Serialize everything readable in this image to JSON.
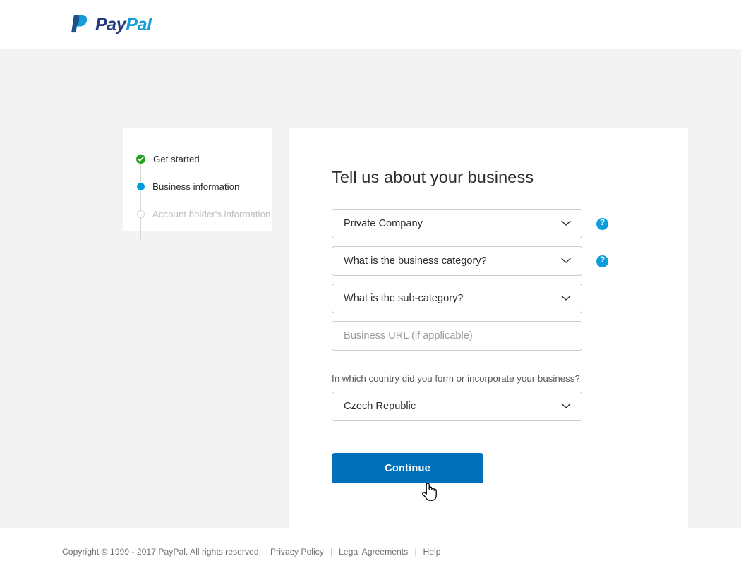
{
  "header": {
    "logo_icon": "paypal-logo-icon",
    "brand_first": "Pay",
    "brand_second": "Pal"
  },
  "progress": {
    "steps": [
      {
        "label": "Get started",
        "state": "done",
        "marker_icon": "check-circle-icon"
      },
      {
        "label": "Business information",
        "state": "current",
        "marker_icon": "filled-dot-icon"
      },
      {
        "label": "Account holder's information",
        "state": "pending",
        "marker_icon": "hollow-circle-icon"
      }
    ]
  },
  "form": {
    "title": "Tell us about your business",
    "business_type": {
      "value": "Private Company",
      "help_label": "?",
      "chevron_icon": "chevron-down-icon"
    },
    "business_category": {
      "value": "What is the business category?",
      "help_label": "?",
      "chevron_icon": "chevron-down-icon"
    },
    "sub_category": {
      "value": "What is the sub-category?",
      "chevron_icon": "chevron-down-icon"
    },
    "business_url": {
      "placeholder": "Business URL (if applicable)"
    },
    "country": {
      "label": "In which country did you form or incorporate your business?",
      "value": "Czech Republic",
      "chevron_icon": "chevron-down-icon"
    },
    "submit_label": "Continue"
  },
  "footer": {
    "copyright": "Copyright © 1999 - 2017 PayPal. All rights reserved.",
    "links": [
      {
        "label": "Privacy Policy"
      },
      {
        "label": "Legal Agreements"
      },
      {
        "label": "Help"
      }
    ]
  },
  "cursor": {
    "icon": "pointing-hand-cursor"
  },
  "colors": {
    "brand_blue": "#0070ba",
    "accent_blue": "#009cde",
    "logo_dark": "#253b80",
    "logo_light": "#179bd7",
    "success_green": "#21a121",
    "page_bg": "#f3f3f3"
  }
}
